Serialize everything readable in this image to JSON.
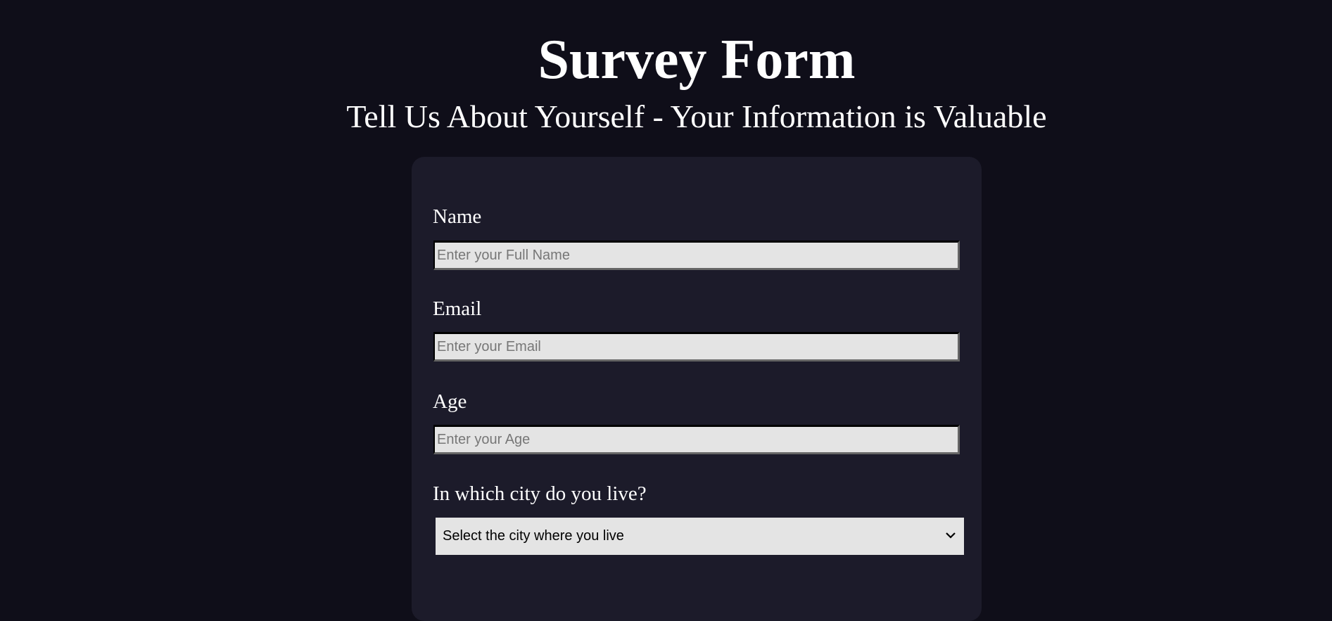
{
  "header": {
    "title": "Survey Form",
    "subtitle": "Tell Us About Yourself - Your Information is Valuable"
  },
  "form": {
    "name": {
      "label": "Name",
      "placeholder": "Enter your Full Name"
    },
    "email": {
      "label": "Email",
      "placeholder": "Enter your Email"
    },
    "age": {
      "label": "Age",
      "placeholder": "Enter your Age"
    },
    "city": {
      "label": "In which city do you live?",
      "selected": "Select the city where you live",
      "icon": "chevron-down-icon"
    }
  }
}
